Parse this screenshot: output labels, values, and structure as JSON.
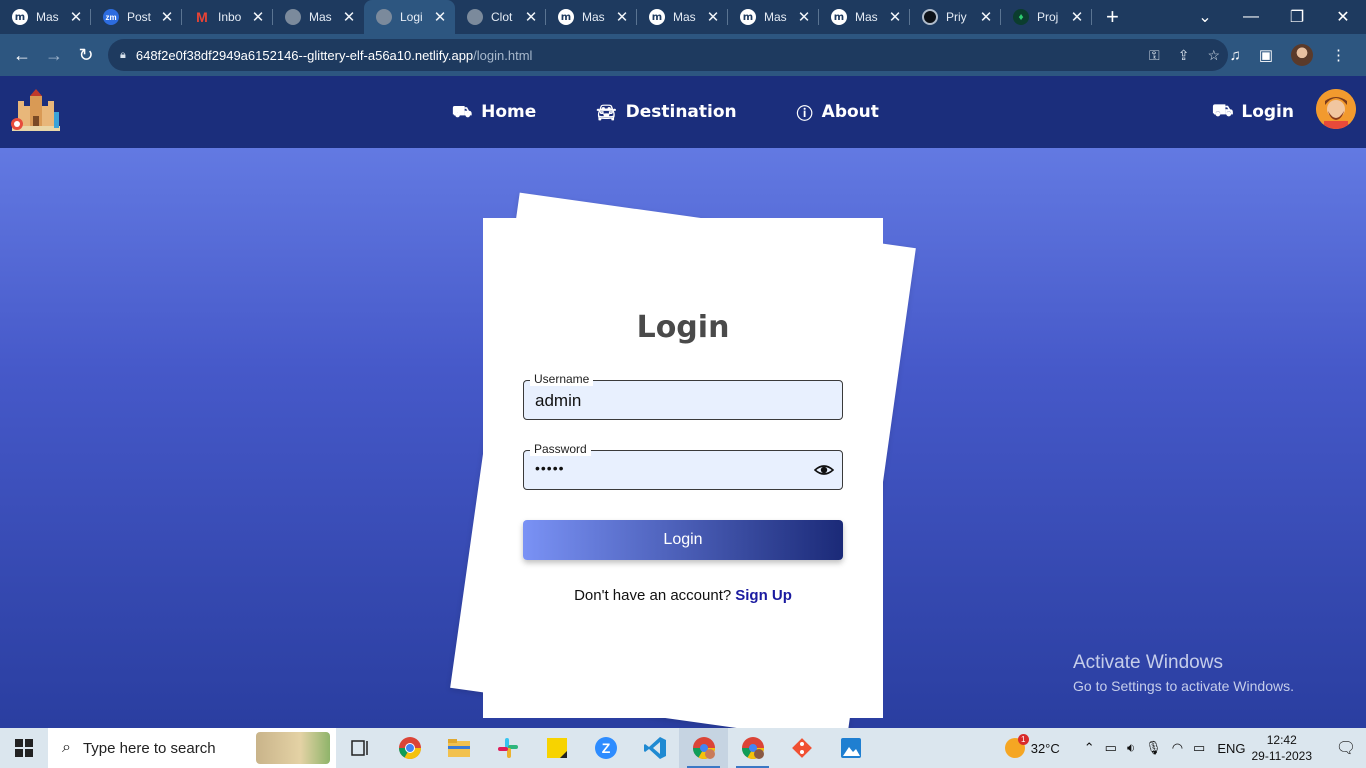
{
  "browser": {
    "tabs": [
      {
        "title": "Mas",
        "icon": "m-icon"
      },
      {
        "title": "Post",
        "icon": "zm-icon"
      },
      {
        "title": "Inbo",
        "icon": "gmail-icon"
      },
      {
        "title": "Mas",
        "icon": "globe-icon"
      },
      {
        "title": "Logi",
        "icon": "globe-icon",
        "active": true
      },
      {
        "title": "Clot",
        "icon": "globe-icon"
      },
      {
        "title": "Mas",
        "icon": "m-icon"
      },
      {
        "title": "Mas",
        "icon": "m-icon"
      },
      {
        "title": "Mas",
        "icon": "m-icon"
      },
      {
        "title": "Mas",
        "icon": "m-icon"
      },
      {
        "title": "Priy",
        "icon": "github-icon"
      },
      {
        "title": "Proj",
        "icon": "leaf-icon"
      }
    ],
    "url_host": "648f2e0f38df2949a6152146--glittery-elf-a56a10.netlify.app",
    "url_path": "/login.html"
  },
  "site": {
    "nav": {
      "home": "Home",
      "destination": "Destination",
      "about": "About",
      "login": "Login"
    },
    "login_card": {
      "title": "Login",
      "username_label": "Username",
      "username_value": "admin",
      "password_label": "Password",
      "password_masked": "•••••",
      "submit_label": "Login",
      "signup_prompt": "Don't have an account?",
      "signup_link": "Sign Up"
    },
    "watermark": {
      "line1": "Activate Windows",
      "line2": "Go to Settings to activate Windows."
    },
    "colors": {
      "nav_bg": "#1b2e7c",
      "gradient_top": "#6c84ea",
      "gradient_bottom": "#2a3ea0",
      "link": "#1a1aa0"
    }
  },
  "taskbar": {
    "search_placeholder": "Type here to search",
    "temperature": "32°C",
    "weather_badge": "1",
    "language": "ENG",
    "time": "12:42",
    "date": "29-11-2023"
  }
}
